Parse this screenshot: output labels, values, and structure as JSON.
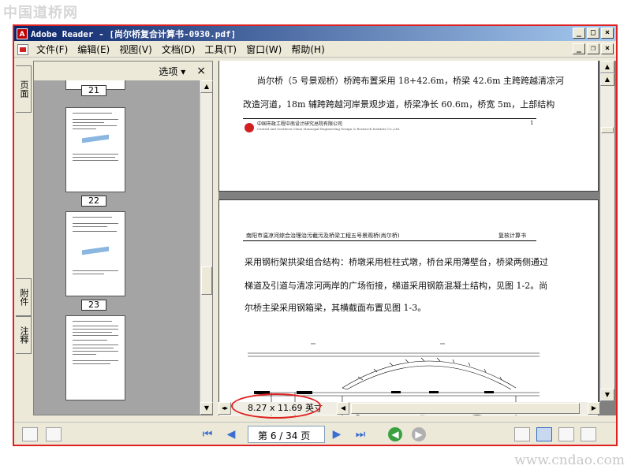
{
  "watermarks": {
    "top": "中国道桥网",
    "bottom": "www.cndao.com"
  },
  "window": {
    "app_icon": "A",
    "title": "Adobe Reader - [尚尔桥复合计算书-0930.pdf]",
    "buttons": [
      "_",
      "□",
      "×"
    ],
    "doc_buttons": [
      "_",
      "❐",
      "×"
    ]
  },
  "menu": [
    "文件(F)",
    "编辑(E)",
    "视图(V)",
    "文档(D)",
    "工具(T)",
    "窗口(W)",
    "帮助(H)"
  ],
  "sidetabs": [
    "页面",
    "附件",
    "注释"
  ],
  "thumbnails": {
    "options_label": "选项",
    "options_arrow": "▾",
    "close": "×",
    "pages": [
      "21",
      "22",
      "23"
    ]
  },
  "page1": {
    "line1": "尚尔桥（5 号景观桥）桥跨布置采用 18+42.6m，桥梁 42.6m 主跨跨越清凉河",
    "line2": "改造河道，18m 辅跨跨越河岸景观步道，桥梁净长 60.6m，桥宽 5m，上部结构",
    "footer_cn": "中国市政工程中南设计研究总院有限公司",
    "footer_en": "Central and Southern China Municipal Engineering Design & Research Institute Co.,Ltd.",
    "page_number": "1"
  },
  "page2": {
    "header_left": "南阳市温凉河综合治理治污截污及桥梁工程五号景观桥(尚尔桥)",
    "header_right": "复核计算书",
    "line1": "采用钢桁架拱梁组合结构：桥墩采用桩柱式墩，桥台采用薄壁台，桥梁两侧通过",
    "line2": "梯道及引道与清凉河两岸的广场衔接，梯道采用钢筋混凝土结构，见图 1-2。尚",
    "line3": "尔桥主梁采用钢箱梁，其横截面布置见图 1-3。"
  },
  "page_size": "8.27 x 11.69 英寸",
  "navigation": {
    "first": "⏮",
    "prev": "◀",
    "page_indicator": "第 6 / 34 页",
    "next": "▶",
    "last": "⏭"
  },
  "colors": {
    "title_bar": "#0a246a",
    "highlight": "#e02020",
    "thumb_bg": "#a4a4a4",
    "doc_bg": "#808080"
  }
}
